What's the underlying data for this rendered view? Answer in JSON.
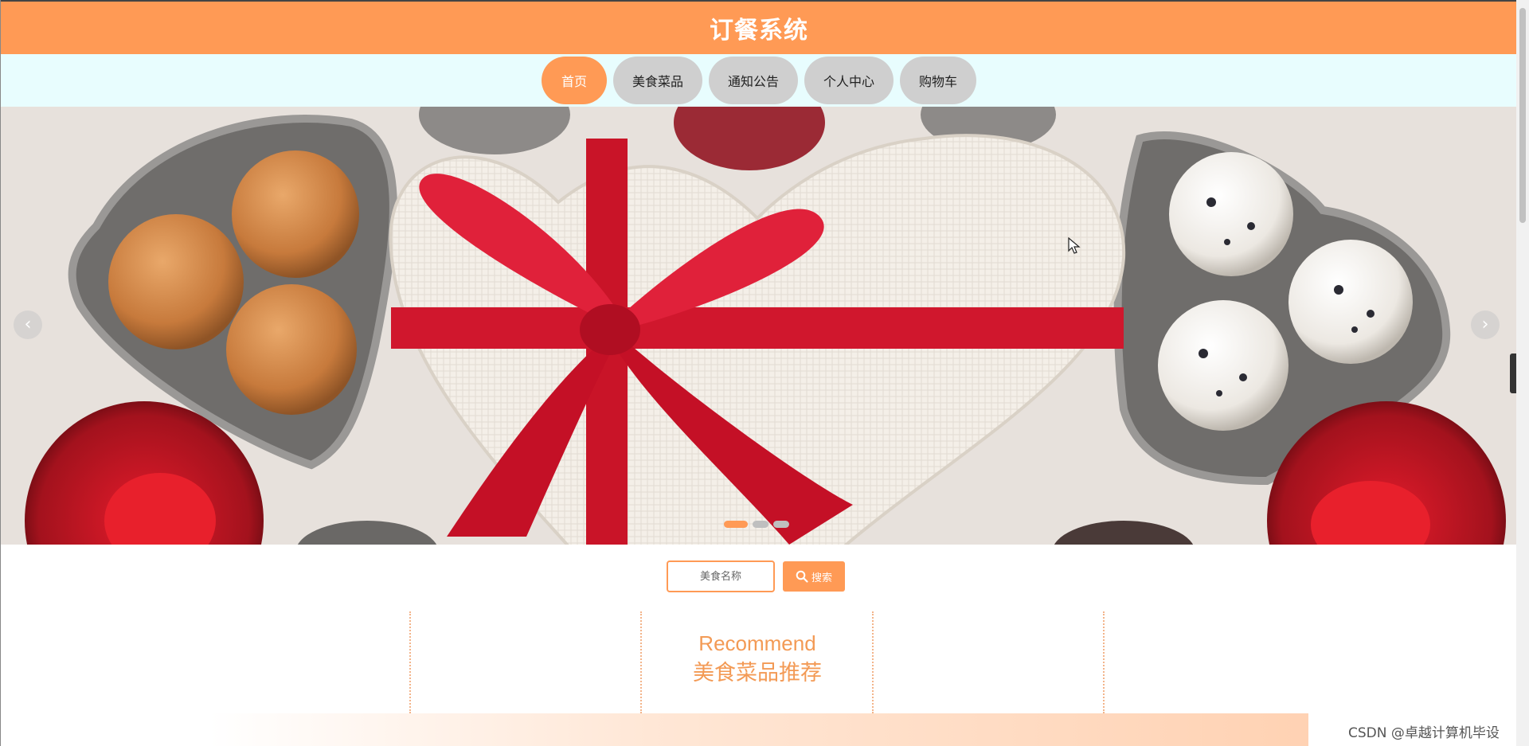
{
  "header": {
    "title": "订餐系统"
  },
  "nav": {
    "items": [
      {
        "label": "首页",
        "active": true
      },
      {
        "label": "美食菜品",
        "active": false
      },
      {
        "label": "通知公告",
        "active": false
      },
      {
        "label": "个人中心",
        "active": false
      },
      {
        "label": "购物车",
        "active": false
      }
    ]
  },
  "carousel": {
    "prev_icon": "chevron-left-icon",
    "next_icon": "chevron-right-icon",
    "slide_count": 3,
    "active_index": 0
  },
  "search": {
    "placeholder": "美食名称",
    "button_label": "搜索",
    "button_icon": "search-icon"
  },
  "recommend": {
    "title_en": "Recommend",
    "title_cn": "美食菜品推荐"
  },
  "watermark": "CSDN @卓越计算机毕设",
  "colors": {
    "accent": "#ff9a55",
    "nav_bg": "#e8fdfe",
    "nav_inactive": "#cfcfcf"
  }
}
